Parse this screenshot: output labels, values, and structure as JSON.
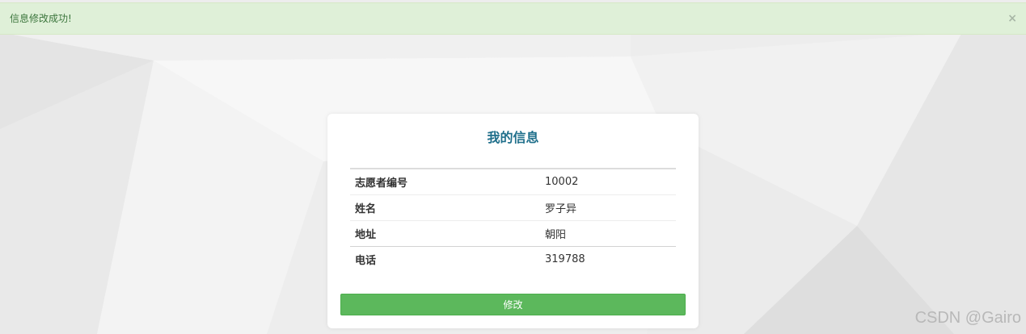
{
  "alert": {
    "message": "信息修改成功!",
    "close_symbol": "×"
  },
  "card": {
    "title": "我的信息",
    "rows": [
      {
        "label": "志愿者编号",
        "value": "10002"
      },
      {
        "label": "姓名",
        "value": "罗子异"
      },
      {
        "label": "地址",
        "value": "朝阳"
      },
      {
        "label": "电话",
        "value": "319788"
      }
    ],
    "edit_button_label": "修改"
  },
  "watermark": "CSDN @Gairo",
  "colors": {
    "alert_bg": "#dff0d8",
    "alert_text": "#3c763d",
    "title_text": "#1f6f8b",
    "button_bg": "#5cb85c"
  }
}
